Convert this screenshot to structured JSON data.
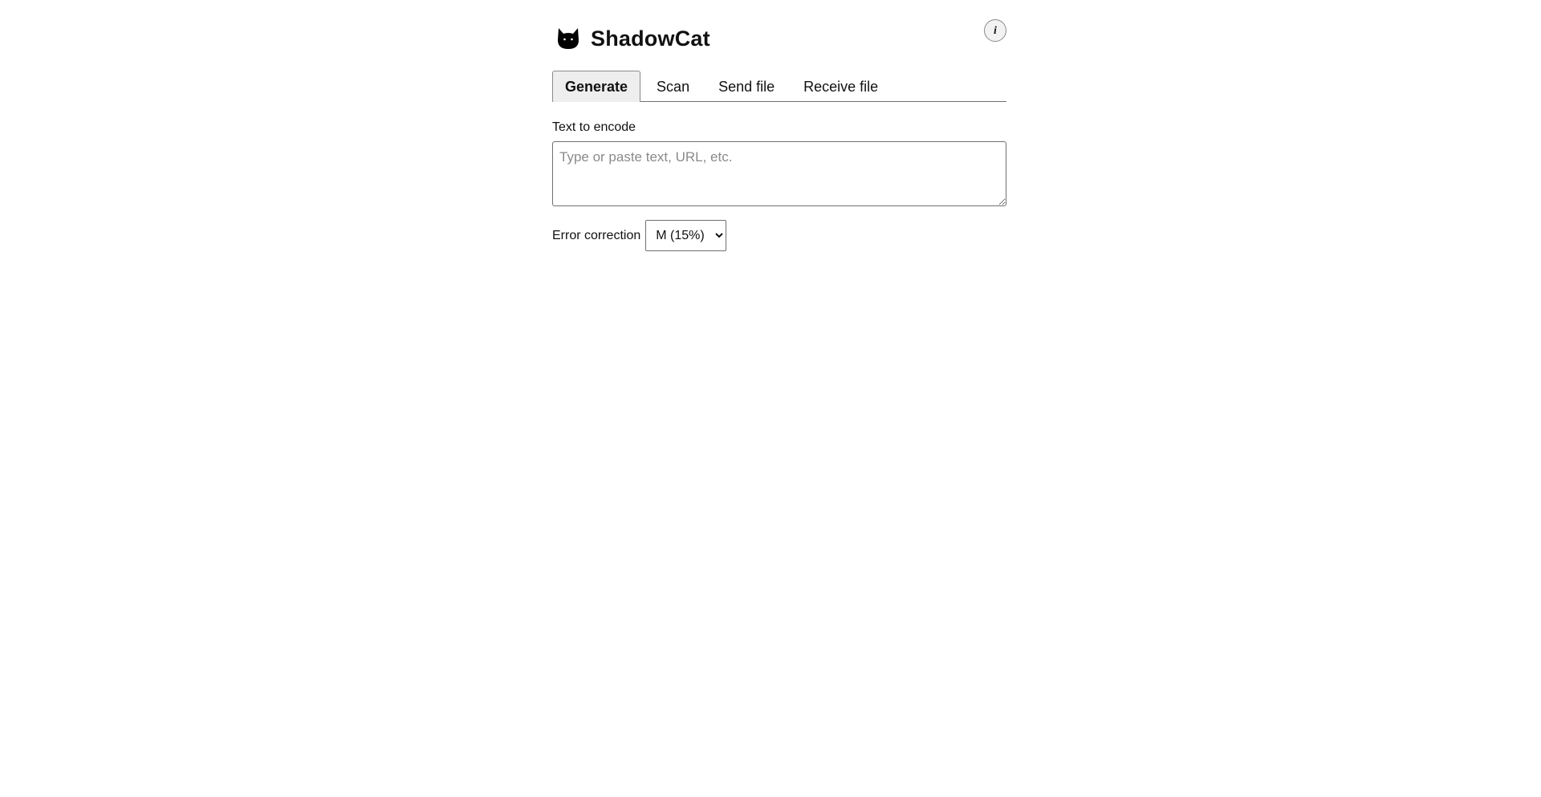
{
  "app": {
    "title": "ShadowCat",
    "logo_icon": "cat-head-icon",
    "info_label": "i"
  },
  "tabs": [
    {
      "label": "Generate",
      "active": true
    },
    {
      "label": "Scan",
      "active": false
    },
    {
      "label": "Send file",
      "active": false
    },
    {
      "label": "Receive file",
      "active": false
    }
  ],
  "generate": {
    "text_label": "Text to encode",
    "text_value": "",
    "text_placeholder": "Type or paste text, URL, etc.",
    "ec_label": "Error correction",
    "ec_selected": "M (15%)"
  }
}
